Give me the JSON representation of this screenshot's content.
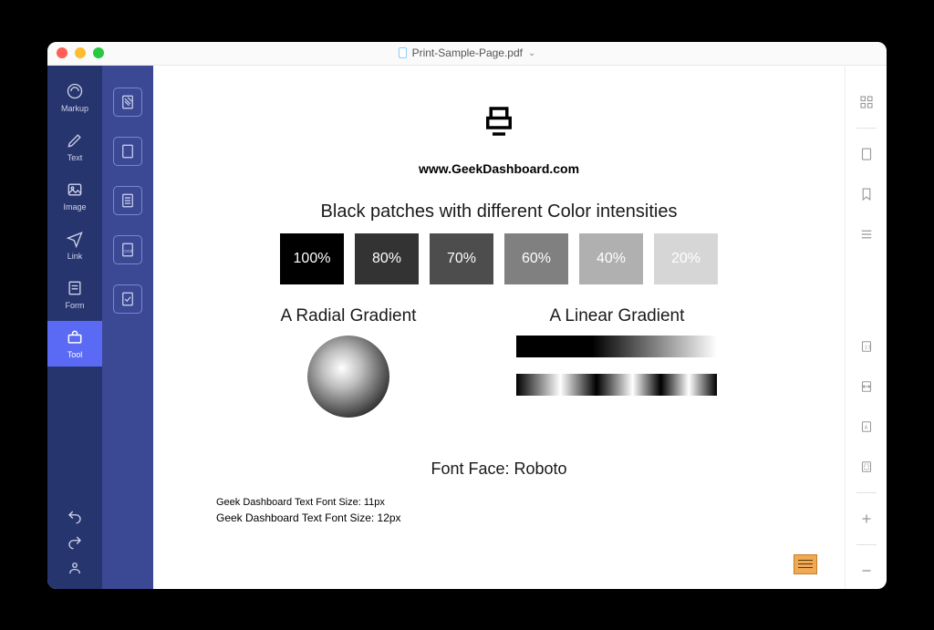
{
  "window": {
    "title": "Print-Sample-Page.pdf"
  },
  "sidebar": {
    "items": [
      {
        "label": "Markup"
      },
      {
        "label": "Text"
      },
      {
        "label": "Image"
      },
      {
        "label": "Link"
      },
      {
        "label": "Form"
      },
      {
        "label": "Tool"
      }
    ]
  },
  "doc": {
    "url": "www.GeekDashboard.com",
    "patches_title": "Black patches with different Color intensities",
    "patches": [
      "100%",
      "80%",
      "70%",
      "60%",
      "40%",
      "20%"
    ],
    "radial_label": "A Radial Gradient",
    "linear_label": "A Linear Gradient",
    "font_face": "Font Face: Roboto",
    "font_samples": [
      "Geek Dashboard Text Font Size: 11px",
      "Geek Dashboard Text Font Size: 12px"
    ]
  }
}
